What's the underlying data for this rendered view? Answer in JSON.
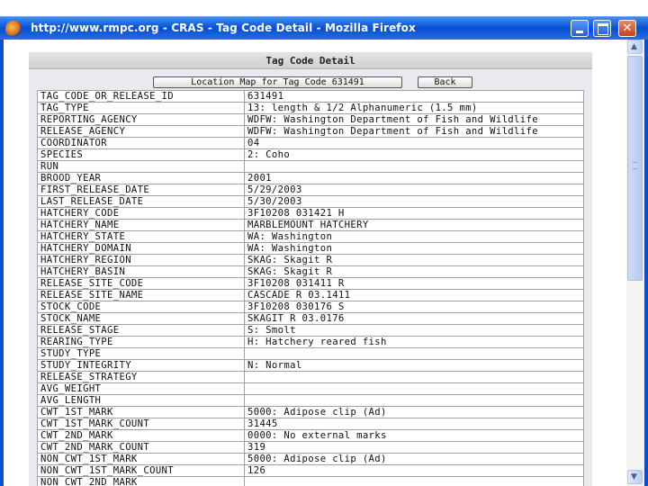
{
  "window": {
    "title": "http://www.rmpc.org - CRAS - Tag Code Detail - Mozilla Firefox",
    "close_glyph": "✕"
  },
  "page": {
    "heading": "Tag Code Detail",
    "map_button": "Location Map for Tag Code 631491",
    "back_button": "Back"
  },
  "rows": [
    [
      "TAG_CODE_OR_RELEASE_ID",
      "631491"
    ],
    [
      "TAG_TYPE",
      "13: length & 1/2 Alphanumeric (1.5 mm)"
    ],
    [
      "REPORTING_AGENCY",
      "WDFW: Washington Department of Fish and Wildlife"
    ],
    [
      "RELEASE_AGENCY",
      "WDFW: Washington Department of Fish and Wildlife"
    ],
    [
      "COORDINATOR",
      "04"
    ],
    [
      "SPECIES",
      "2: Coho"
    ],
    [
      "RUN",
      ""
    ],
    [
      "BROOD_YEAR",
      "2001"
    ],
    [
      "FIRST_RELEASE_DATE",
      "5/29/2003"
    ],
    [
      "LAST_RELEASE_DATE",
      "5/30/2003"
    ],
    [
      "HATCHERY_CODE",
      "3F10208 031421 H"
    ],
    [
      "HATCHERY_NAME",
      "MARBLEMOUNT HATCHERY"
    ],
    [
      "HATCHERY_STATE",
      "WA: Washington"
    ],
    [
      "HATCHERY_DOMAIN",
      "WA: Washington"
    ],
    [
      "HATCHERY_REGION",
      "SKAG: Skagit R"
    ],
    [
      "HATCHERY_BASIN",
      "SKAG: Skagit R"
    ],
    [
      "RELEASE_SITE_CODE",
      "3F10208 031411 R"
    ],
    [
      "RELEASE_SITE_NAME",
      "CASCADE R 03.1411"
    ],
    [
      "STOCK_CODE",
      "3F10208 030176 S"
    ],
    [
      "STOCK_NAME",
      "SKAGIT R 03.0176"
    ],
    [
      "RELEASE_STAGE",
      "S: Smolt"
    ],
    [
      "REARING_TYPE",
      "H: Hatchery reared fish"
    ],
    [
      "STUDY_TYPE",
      ""
    ],
    [
      "STUDY_INTEGRITY",
      "N: Normal"
    ],
    [
      "RELEASE_STRATEGY",
      ""
    ],
    [
      "AVG_WEIGHT",
      ""
    ],
    [
      "AVG_LENGTH",
      ""
    ],
    [
      "CWT_1ST_MARK",
      "5000: Adipose clip (Ad)"
    ],
    [
      "CWT_1ST_MARK_COUNT",
      "31445"
    ],
    [
      "CWT_2ND_MARK",
      "0000: No external marks"
    ],
    [
      "CWT_2ND_MARK_COUNT",
      "319"
    ],
    [
      "NON_CWT_1ST_MARK",
      "5000: Adipose clip (Ad)"
    ],
    [
      "NON_CWT_1ST_MARK_COUNT",
      "126"
    ],
    [
      "NON_CWT_2ND_MARK",
      ""
    ]
  ]
}
